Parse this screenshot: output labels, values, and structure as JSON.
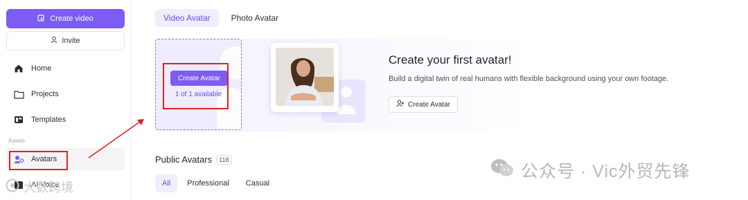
{
  "sidebar": {
    "create_video_label": "Create video",
    "invite_label": "Invite",
    "nav": [
      {
        "label": "Home",
        "icon": "home-icon"
      },
      {
        "label": "Projects",
        "icon": "folder-icon"
      },
      {
        "label": "Templates",
        "icon": "template-icon"
      }
    ],
    "section_label": "Assets",
    "avatars_label": "Avatars",
    "ai_voice_label": "AI Voice"
  },
  "tabs": [
    "Video Avatar",
    "Photo Avatar"
  ],
  "create_card": {
    "button_label": "Create Avatar",
    "available_text": "1 of 1 available"
  },
  "hero": {
    "title": "Create your first avatar!",
    "subtitle": "Build a digital twin of real humans with flexible background using your own footage.",
    "button_label": "Create Avatar"
  },
  "public": {
    "title": "Public Avatars",
    "count": "118",
    "filters": [
      "All",
      "Professional",
      "Casual"
    ]
  },
  "watermark": {
    "text": "公众号 · Vic外贸先锋",
    "bottom_text": "大数跨境"
  },
  "colors": {
    "accent": "#7c5cf3",
    "annotation_red": "#e02020"
  }
}
